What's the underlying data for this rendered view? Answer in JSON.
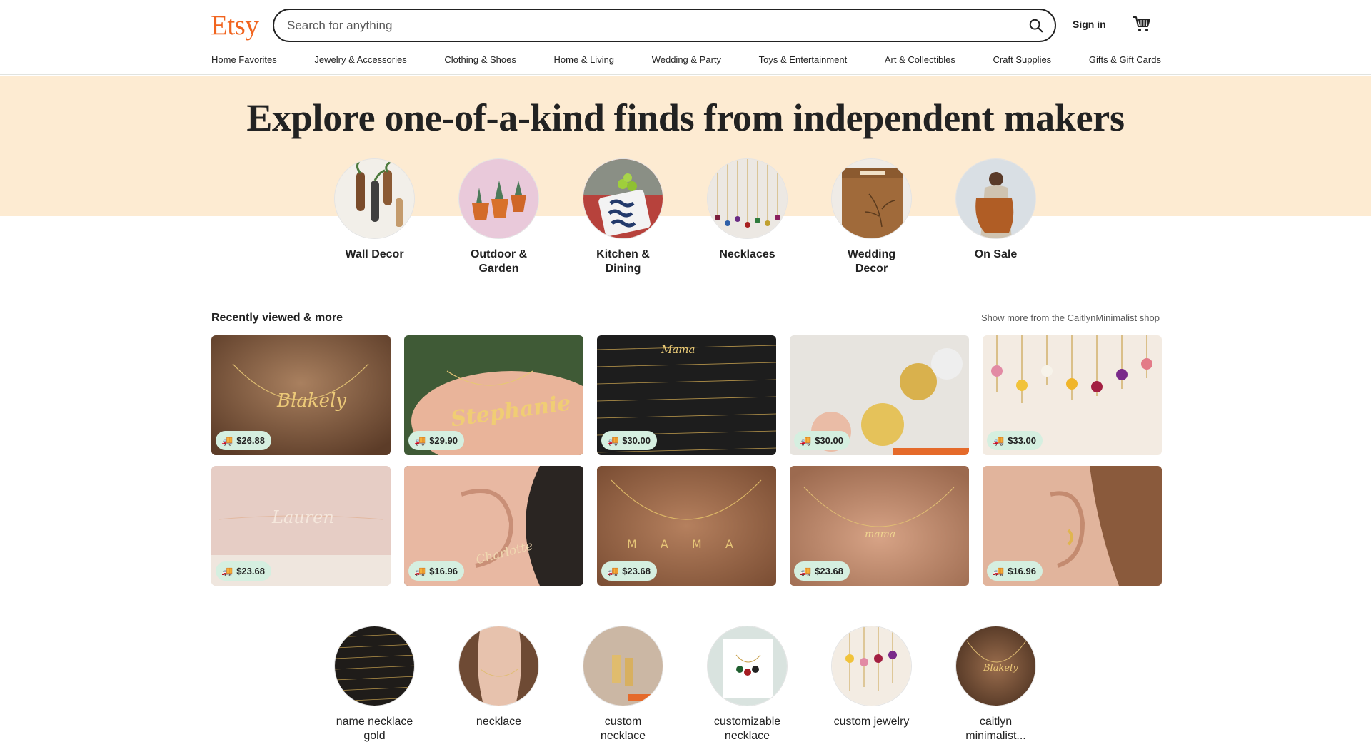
{
  "header": {
    "logo": "Etsy",
    "search_placeholder": "Search for anything",
    "signin_label": "Sign in",
    "cart_icon": "shopping-cart-icon",
    "search_icon": "search-icon"
  },
  "nav": [
    "Home Favorites",
    "Jewelry & Accessories",
    "Clothing & Shoes",
    "Home & Living",
    "Wedding & Party",
    "Toys & Entertainment",
    "Art & Collectibles",
    "Craft Supplies",
    "Gifts & Gift Cards"
  ],
  "hero": {
    "title": "Explore one-of-a-kind finds from independent makers",
    "band_color": "#FDEBD2"
  },
  "categories": [
    {
      "label": "Wall Decor"
    },
    {
      "label": "Outdoor & Garden"
    },
    {
      "label": "Kitchen & Dining"
    },
    {
      "label": "Necklaces"
    },
    {
      "label": "Wedding Decor"
    },
    {
      "label": "On Sale"
    }
  ],
  "recently_viewed": {
    "title": "Recently viewed & more",
    "more_prefix": "Show more from the",
    "shop_name": "CaitlynMinimalist",
    "more_suffix": "shop",
    "items": [
      {
        "price": "$26.88",
        "text": "Blakely"
      },
      {
        "price": "$29.90",
        "text": "Stephanie"
      },
      {
        "price": "$30.00",
        "text": "Mama"
      },
      {
        "price": "$30.00",
        "text": ""
      },
      {
        "price": "$33.00",
        "text": ""
      },
      {
        "price": "$23.68",
        "text": "Lauren"
      },
      {
        "price": "$16.96",
        "text": "Charlotte"
      },
      {
        "price": "$23.68",
        "text": "M A M A"
      },
      {
        "price": "$23.68",
        "text": "mama"
      },
      {
        "price": "$16.96",
        "text": ""
      }
    ]
  },
  "suggestions": [
    {
      "label": "name necklace gold"
    },
    {
      "label": "necklace"
    },
    {
      "label": "custom necklace"
    },
    {
      "label": "customizable necklace"
    },
    {
      "label": "custom jewelry"
    },
    {
      "label": "caitlyn minimalist..."
    }
  ],
  "colors": {
    "brand": "#F1641E",
    "price_badge": "#d5efe0"
  }
}
